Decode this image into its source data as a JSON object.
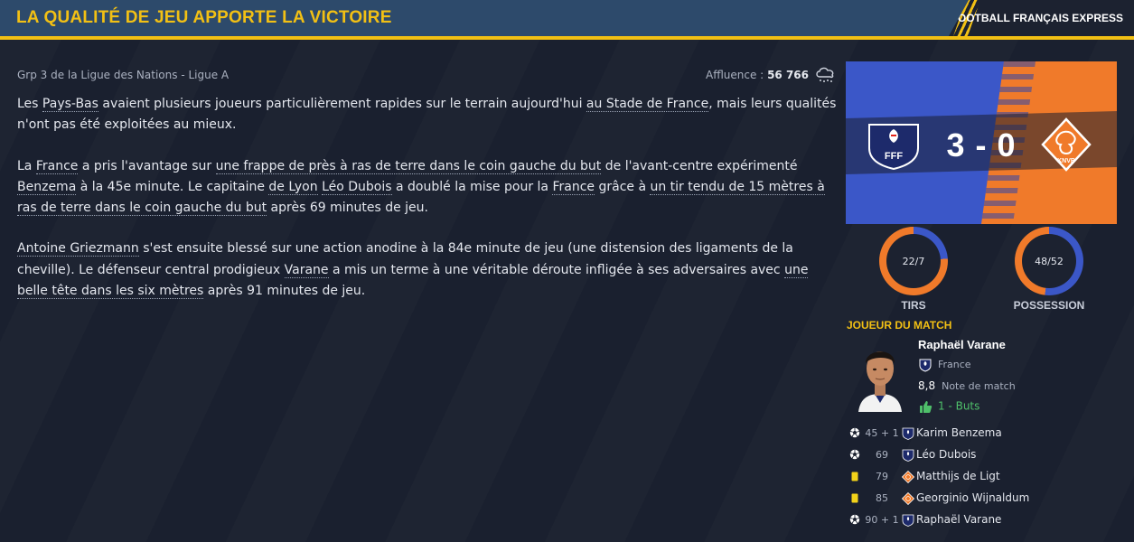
{
  "header": {
    "title": "LA QUALITÉ DE JEU APPORTE LA VICTOIRE",
    "source": "FOOTBALL FRANÇAIS EXPRESS"
  },
  "meta": {
    "competition": "Grp 3 de la Ligue des Nations - Ligue A",
    "attendance_label": "Affluence :",
    "attendance_value": "56 766",
    "weather_icon": "rain-cloud-icon"
  },
  "article": {
    "p1": [
      {
        "t": "Les "
      },
      {
        "t": "Pays-Bas",
        "link": true
      },
      {
        "t": " avaient plusieurs joueurs particulièrement rapides sur le terrain aujourd'hui "
      },
      {
        "t": "au Stade de France",
        "link": true
      },
      {
        "t": ", mais leurs qualités n'ont pas été exploitées au mieux."
      }
    ],
    "p2": [
      {
        "t": "La "
      },
      {
        "t": "France",
        "link": true
      },
      {
        "t": " a pris l'avantage sur "
      },
      {
        "t": "une frappe de près à ras de terre dans le coin gauche du but",
        "link": true
      },
      {
        "t": " de l'avant-centre expérimenté "
      },
      {
        "t": "Benzema",
        "link": true
      },
      {
        "t": " à la 45e minute. Le capitaine "
      },
      {
        "t": "de Lyon",
        "link": true
      },
      {
        "t": " "
      },
      {
        "t": "Léo Dubois",
        "link": true
      },
      {
        "t": " a doublé la mise pour la "
      },
      {
        "t": "France",
        "link": true
      },
      {
        "t": " grâce à "
      },
      {
        "t": "un tir tendu de 15 mètres à ras de terre dans le coin gauche du but",
        "link": true
      },
      {
        "t": " après 69 minutes de jeu."
      }
    ],
    "p3": [
      {
        "t": "Antoine Griezmann",
        "link": true
      },
      {
        "t": " s'est ensuite blessé sur une action anodine à la 84e minute de jeu (une distension des ligaments de la cheville). Le défenseur central prodigieux "
      },
      {
        "t": "Varane",
        "link": true
      },
      {
        "t": " a mis un terme à une véritable déroute infligée à ses adversaires avec "
      },
      {
        "t": "une belle tête dans les six mètres",
        "link": true
      },
      {
        "t": " après 91 minutes de jeu."
      }
    ]
  },
  "scoreboard": {
    "score": "3 - 0",
    "home_crest": "fff-crest-icon",
    "home_crest_text": "FFF",
    "away_crest": "knvb-crest-icon",
    "away_crest_text": "KNVB",
    "home_color": "#3b57c8",
    "away_color": "#f07a2a"
  },
  "stats": [
    {
      "label": "TIRS",
      "value": "22/7",
      "home_fraction": 0.76
    },
    {
      "label": "POSSESSION",
      "value": "48/52",
      "home_fraction": 0.48
    }
  ],
  "potm": {
    "title": "JOUEUR DU MATCH",
    "name": "Raphaël Varane",
    "country": "France",
    "rating": "8,8",
    "rating_label": "Note de match",
    "goals": "1 - Buts"
  },
  "events": [
    {
      "icon": "ball-icon",
      "minute": "45 + 1",
      "team": "fra",
      "player": "Karim Benzema"
    },
    {
      "icon": "ball-icon",
      "minute": "69",
      "team": "fra",
      "player": "Léo Dubois"
    },
    {
      "icon": "yellow-card-icon",
      "minute": "79",
      "team": "ned",
      "player": "Matthijs de Ligt"
    },
    {
      "icon": "yellow-card-icon",
      "minute": "85",
      "team": "ned",
      "player": "Georginio Wijnaldum"
    },
    {
      "icon": "ball-icon",
      "minute": "90 + 1",
      "team": "fra",
      "player": "Raphaël Varane"
    }
  ],
  "colors": {
    "accent": "#f2c014",
    "header_bg": "#2d4a6b",
    "page_bg": "#1c2230",
    "ring_home": "#3b57c8",
    "ring_away": "#f07a2a",
    "goal_green": "#4fc06a"
  }
}
